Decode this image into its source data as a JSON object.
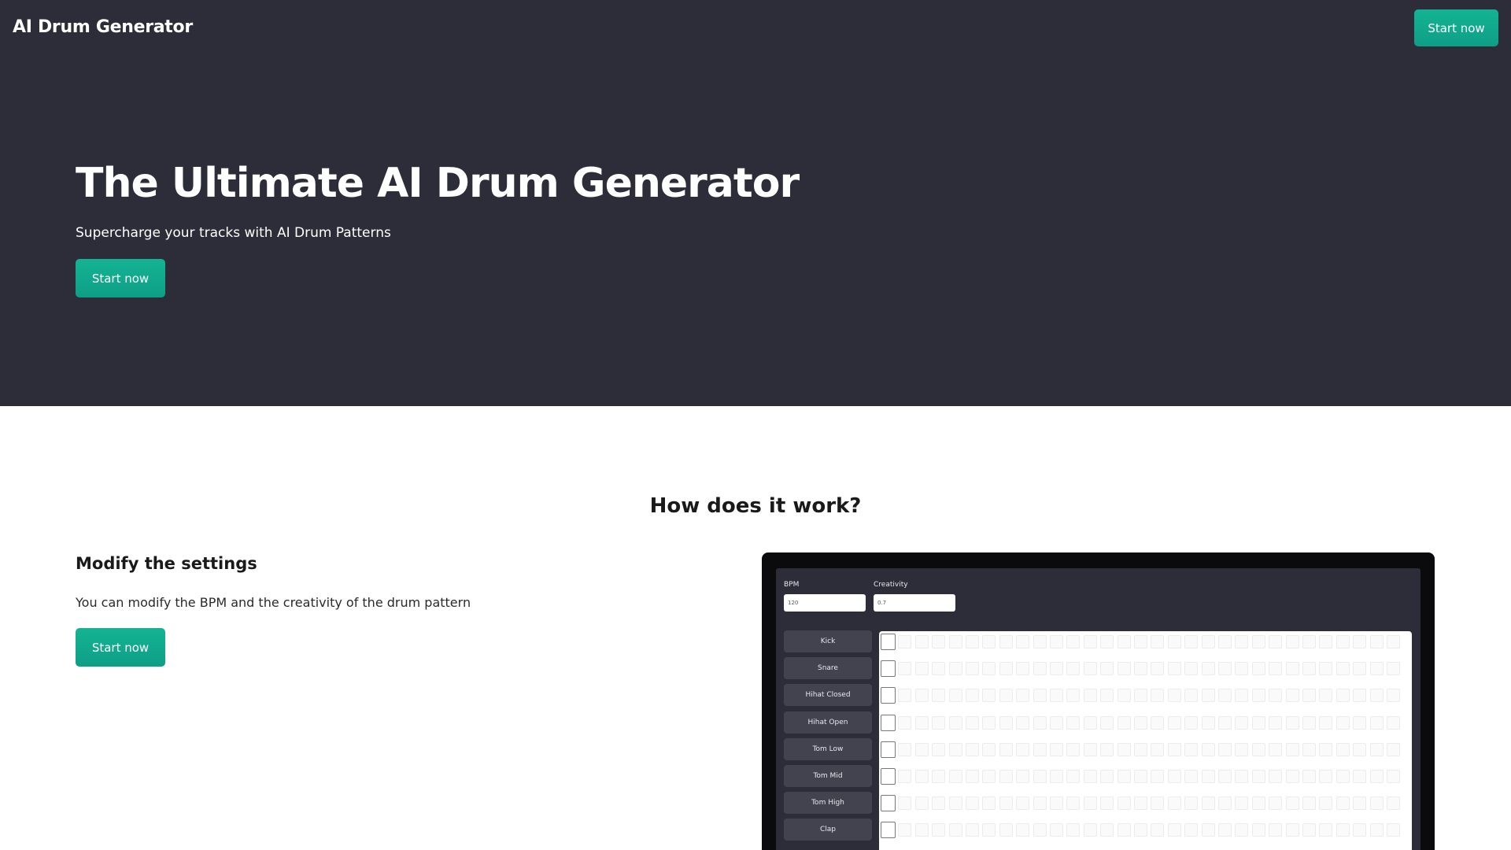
{
  "header": {
    "brand": "AI Drum Generator",
    "cta_label": "Start now"
  },
  "hero": {
    "title": "The Ultimate AI Drum Generator",
    "subtitle": "Supercharge your tracks with AI Drum Patterns",
    "cta_label": "Start now"
  },
  "how": {
    "title": "How does it work?",
    "feature": {
      "title": "Modify the settings",
      "description": "You can modify the BPM and the creativity of the drum pattern",
      "cta_label": "Start now"
    }
  },
  "mockup": {
    "bpm_label": "BPM",
    "bpm_value": "120",
    "creativity_label": "Creativity",
    "creativity_value": "0.7",
    "tracks": [
      "Kick",
      "Snare",
      "Hihat Closed",
      "Hihat Open",
      "Tom Low",
      "Tom Mid",
      "Tom High",
      "Clap"
    ]
  },
  "colors": {
    "hero_bg": "#2c2d38",
    "accent": "#12a98e",
    "page_bg": "#ffffff"
  }
}
